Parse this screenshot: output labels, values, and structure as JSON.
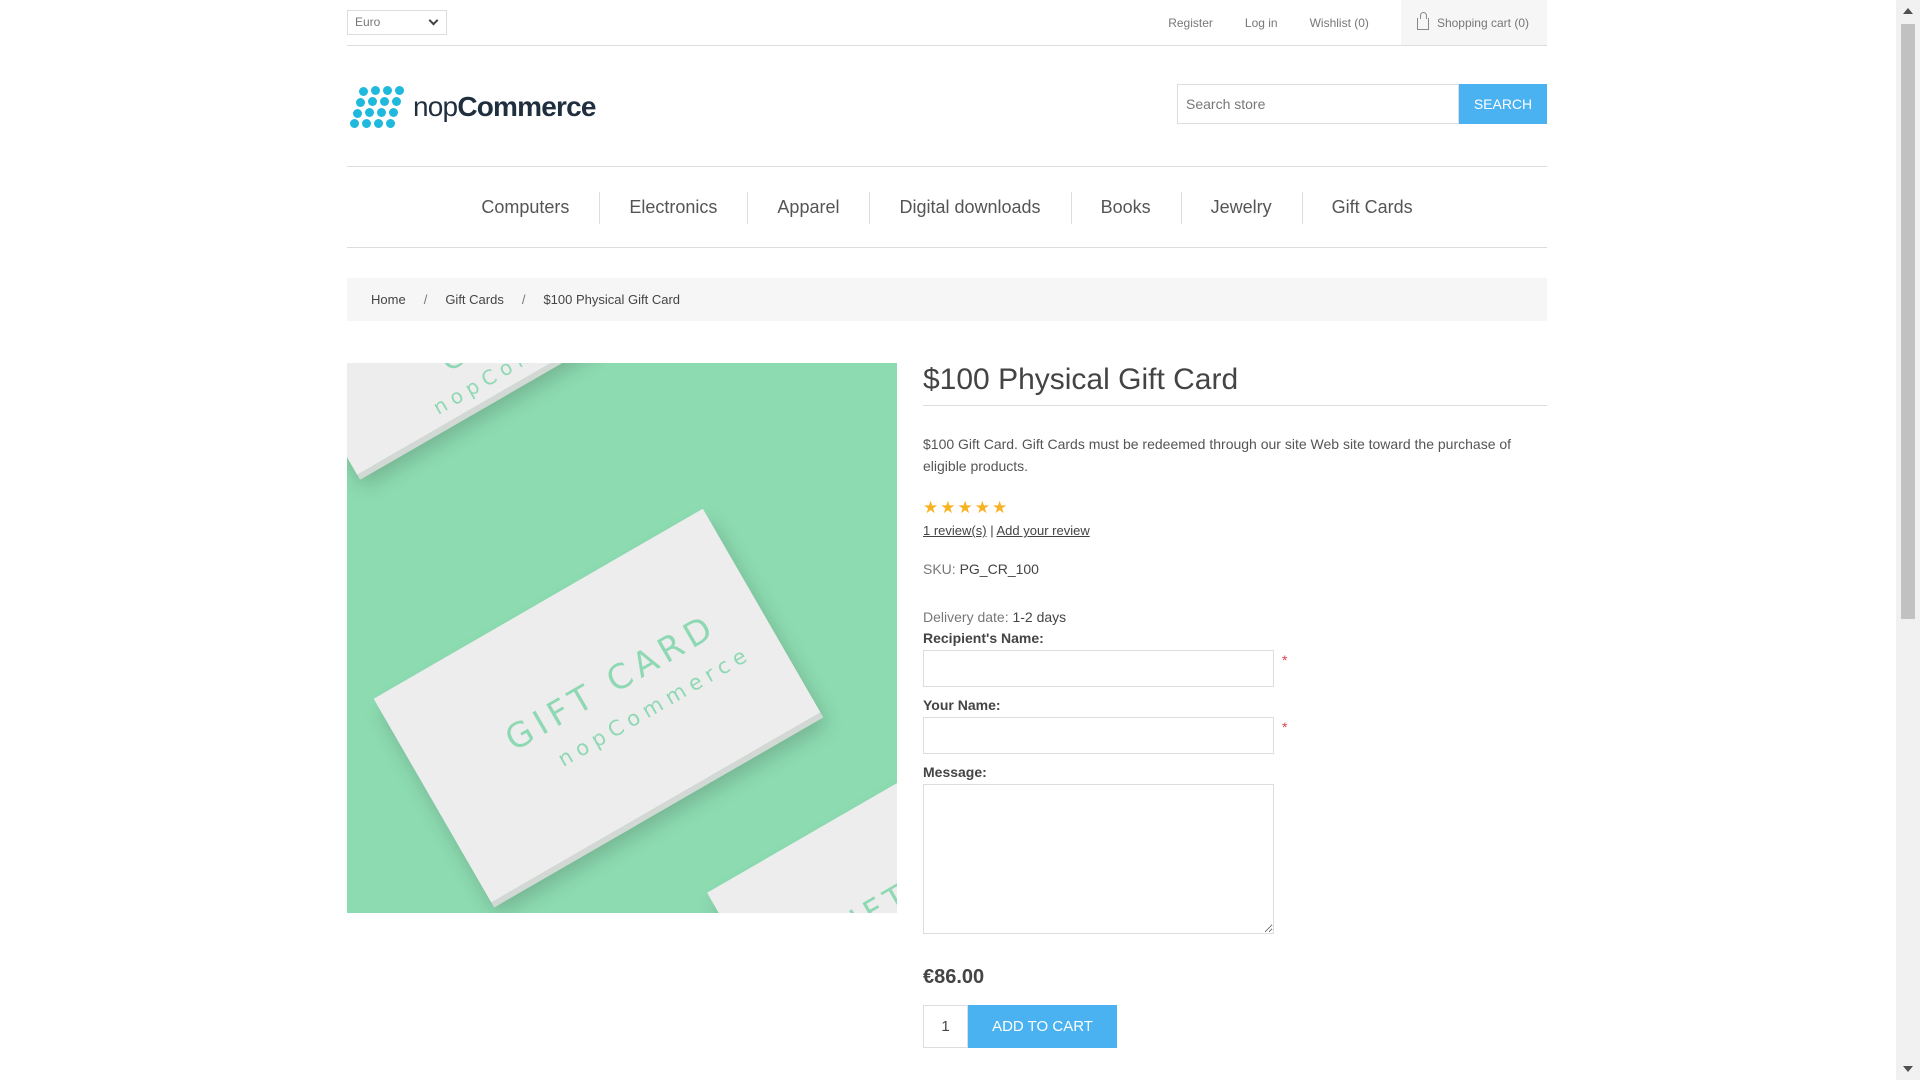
{
  "header": {
    "currency": "Euro",
    "links": {
      "register": "Register",
      "login": "Log in",
      "wishlist": "Wishlist (0)",
      "cart": "Shopping cart (0)"
    },
    "logo": {
      "part1": "nop",
      "part2": "Commerce"
    },
    "search": {
      "placeholder": "Search store",
      "button": "SEARCH"
    }
  },
  "menu": [
    "Computers",
    "Electronics",
    "Apparel",
    "Digital downloads",
    "Books",
    "Jewelry",
    "Gift Cards"
  ],
  "breadcrumb": {
    "home": "Home",
    "separator": "/",
    "category": "Gift Cards",
    "current": "$100 Physical Gift Card"
  },
  "product": {
    "image_text": {
      "headline": "GIFT CARD",
      "brand": "nopCommerce"
    },
    "title": "$100 Physical Gift Card",
    "short_description": "$100 Gift Card. Gift Cards must be redeemed through our site Web site toward the purchase of eligible products.",
    "rating": {
      "value": 5,
      "max": 5
    },
    "reviews_link": "1 review(s)",
    "reviews_separator": "|",
    "add_review_link": "Add your review",
    "sku_label": "SKU:",
    "sku": "PG_CR_100",
    "delivery_label": "Delivery date:",
    "delivery": "1-2 days",
    "recipient_label": "Recipient's Name:",
    "recipient_value": "",
    "your_name_label": "Your Name:",
    "your_name_value": "",
    "message_label": "Message:",
    "message_value": "",
    "required_marker": "*",
    "price": "€86.00",
    "quantity": "1",
    "add_to_cart": "ADD TO CART"
  },
  "colors": {
    "accent": "#4ab2f1",
    "image_bg": "#8ddbb1",
    "star": "#f8b323",
    "required": "#e4434b"
  }
}
